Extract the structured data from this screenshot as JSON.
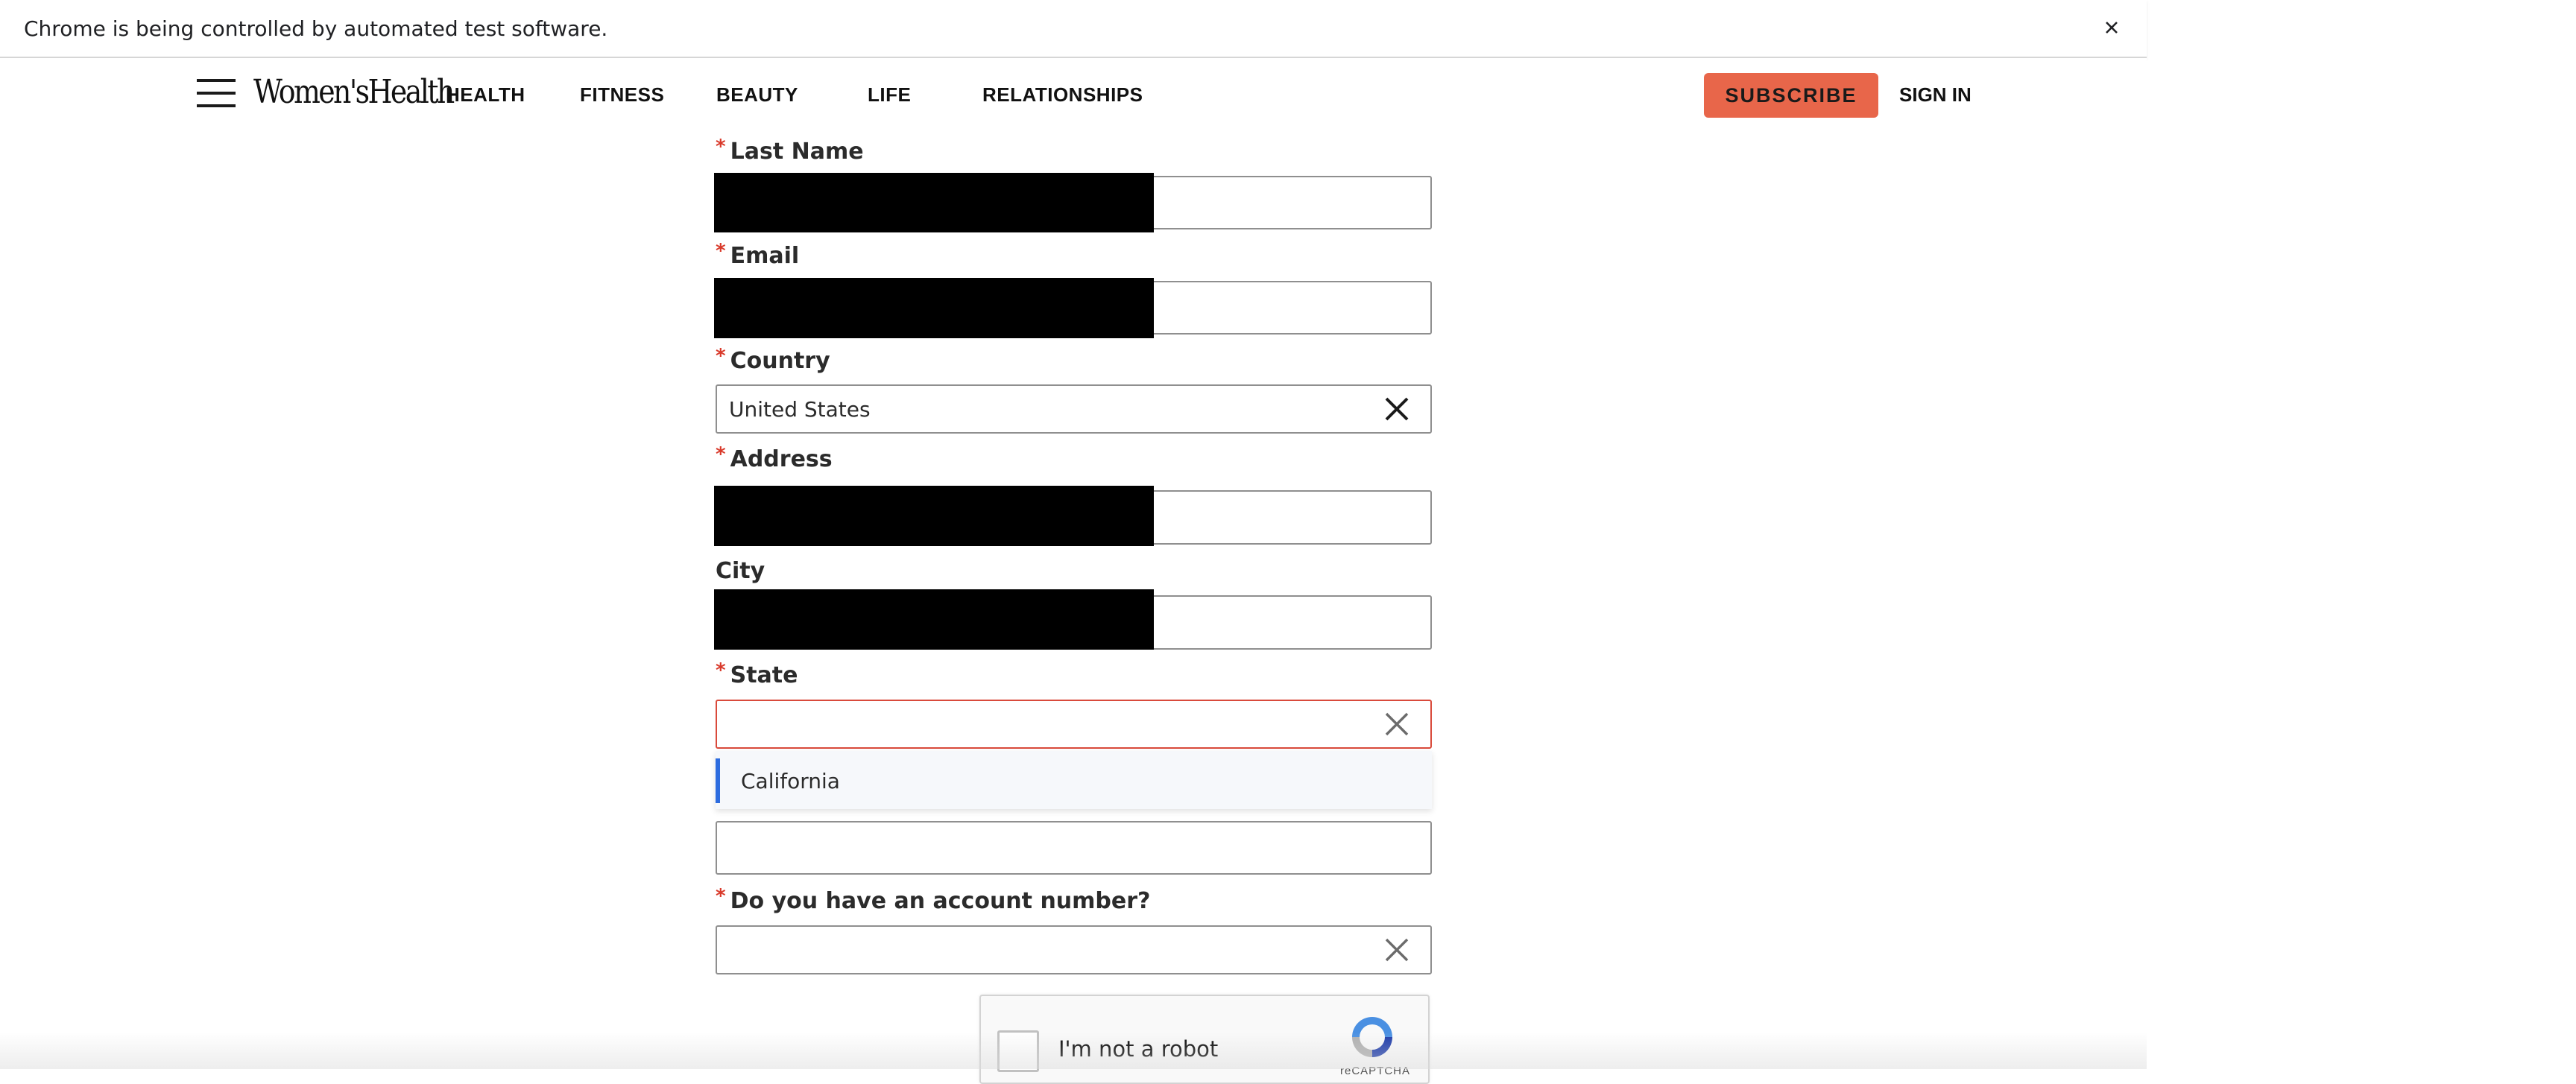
{
  "browser": {
    "infobar_text": "Chrome is being controlled by automated test software.",
    "close_icon": "close-icon"
  },
  "header": {
    "logo": "Women'sHealth",
    "nav": [
      "HEALTH",
      "FITNESS",
      "BEAUTY",
      "LIFE",
      "RELATIONSHIPS"
    ],
    "subscribe_label": "SUBSCRIBE",
    "signin_label": "SIGN IN",
    "accent_color": "#e8664a"
  },
  "form": {
    "required_marker": "*",
    "last_name": {
      "label": "Last Name",
      "value": ""
    },
    "email": {
      "label": "Email",
      "value": ""
    },
    "country": {
      "label": "Country",
      "value": "United States"
    },
    "address": {
      "label": "Address",
      "value": ""
    },
    "city": {
      "label": "City",
      "value": ""
    },
    "state": {
      "label": "State",
      "value": "",
      "dropdown_options": [
        "California"
      ]
    },
    "zip": {
      "label": "",
      "value": ""
    },
    "account_number": {
      "label": "Do you have an account number?",
      "value": ""
    },
    "error_color": "#d94a3b",
    "highlight_color": "#2d6cdf"
  },
  "captcha": {
    "label": "I'm not a robot",
    "brand": "reCAPTCHA"
  }
}
